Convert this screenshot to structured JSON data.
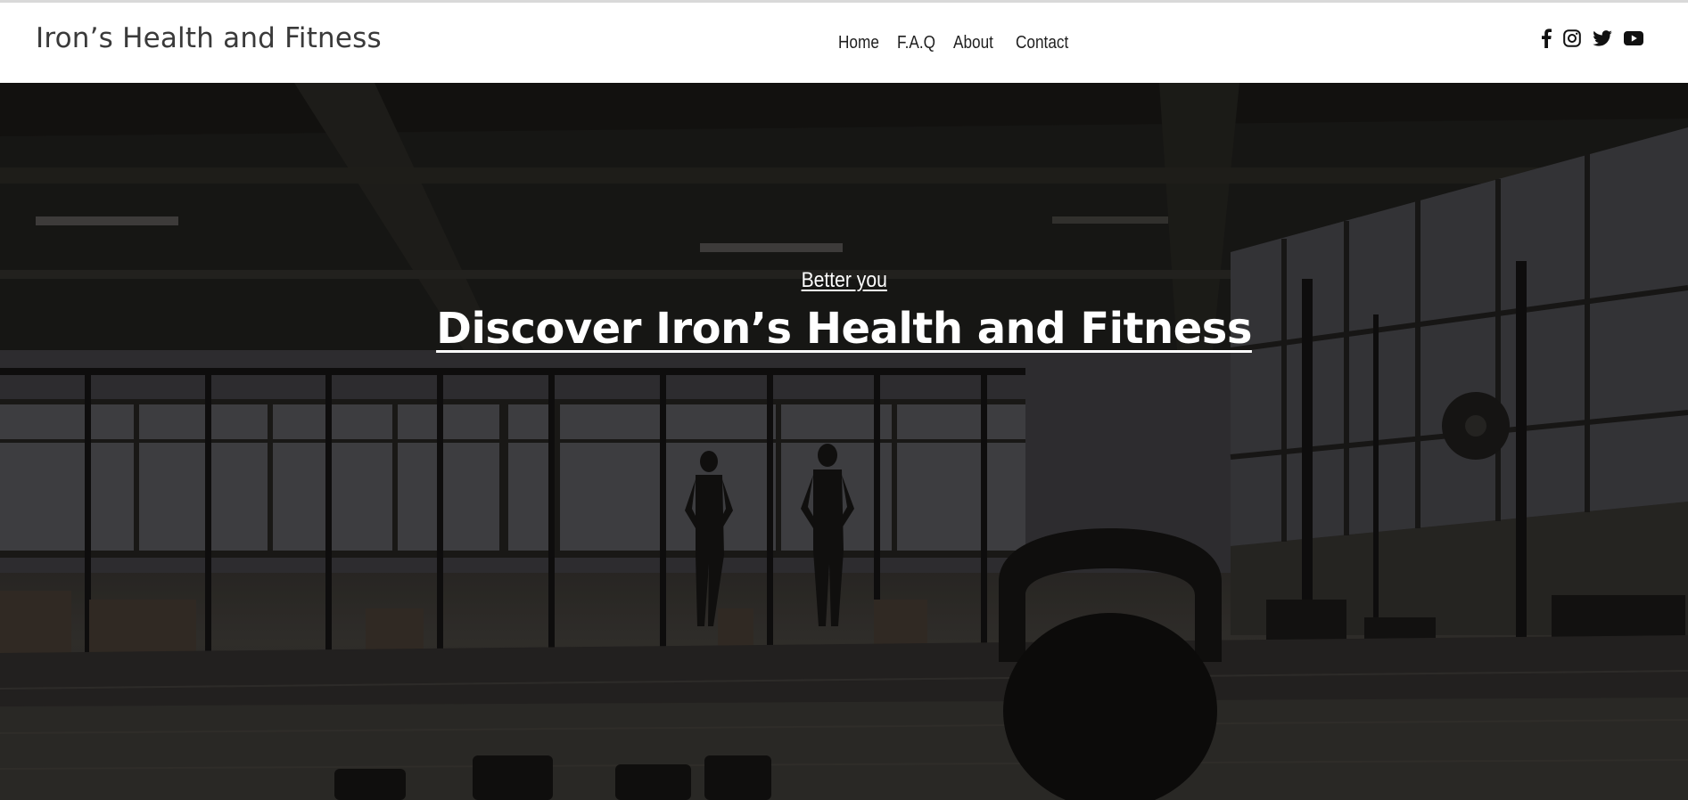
{
  "header": {
    "brand": "Iron’s Health and Fitness",
    "nav": {
      "home": "Home",
      "faq": "F.A.Q",
      "about": "About",
      "contact": "Contact"
    },
    "social": [
      "facebook-icon",
      "instagram-icon",
      "twitter-icon",
      "youtube-icon"
    ]
  },
  "hero": {
    "kicker": "Better you",
    "headline": "Discover Iron’s Health and Fitness"
  },
  "colors": {
    "header_bg": "#ffffff",
    "brand_text": "#3a3a3a",
    "nav_text": "#1f1f1f",
    "hero_text": "#ffffff"
  }
}
